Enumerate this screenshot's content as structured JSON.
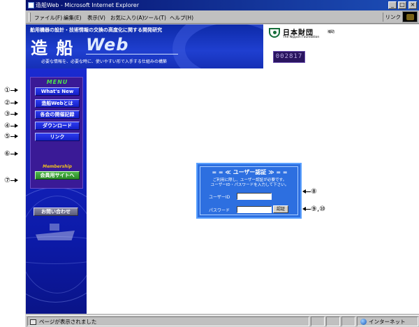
{
  "window": {
    "title": "造船Web - Microsoft Internet Explorer",
    "controls": [
      "_",
      "□",
      "×"
    ]
  },
  "menubar": {
    "items": [
      "ファイル(F)",
      "編集(E)",
      "表示(V)",
      "お気に入り(A)",
      "ツール(T)",
      "ヘルプ(H)"
    ],
    "links": "リンク"
  },
  "header": {
    "tagline": "舶用機器の設計・技術情報の交換の高度化に関する開発研究",
    "logo_kanji": "造 船",
    "logo_web": "Web",
    "subtag": "必要な情報を、必要な時に、使いやすい形で入手する仕組みの構築",
    "sponsor_name": "日本財団",
    "sponsor_en": "The Nippon Foundation",
    "sponsor_note": "補助",
    "counter": "002817"
  },
  "sidebar": {
    "menu_title": "MENU",
    "items": [
      "What's New",
      "造船Webとは",
      "各会の開催記録",
      "ダウンロード",
      "リンク"
    ],
    "membership_label": "Membership",
    "member_button": "会員用サイトへ",
    "contact_button": "お問い合わせ"
  },
  "auth": {
    "title": "= = ≪ ユーザー認証 ≫ = =",
    "message1": "ご利用に際し、ユーザー認証が必要です。",
    "message2": "ユーザーID・パスワードを入力して下さい。",
    "user_label": "ユーザーID",
    "password_label": "パスワード",
    "submit": "認証",
    "user_value": "",
    "password_value": ""
  },
  "statusbar": {
    "message": "ページが表示されました",
    "zone": "インターネット"
  },
  "annotations": {
    "m1": "①",
    "m2": "②",
    "m3": "③",
    "m4": "④",
    "m5": "⑤",
    "m6": "⑥",
    "m7": "⑦",
    "m8": "⑧",
    "m9": "⑨,⑩"
  }
}
